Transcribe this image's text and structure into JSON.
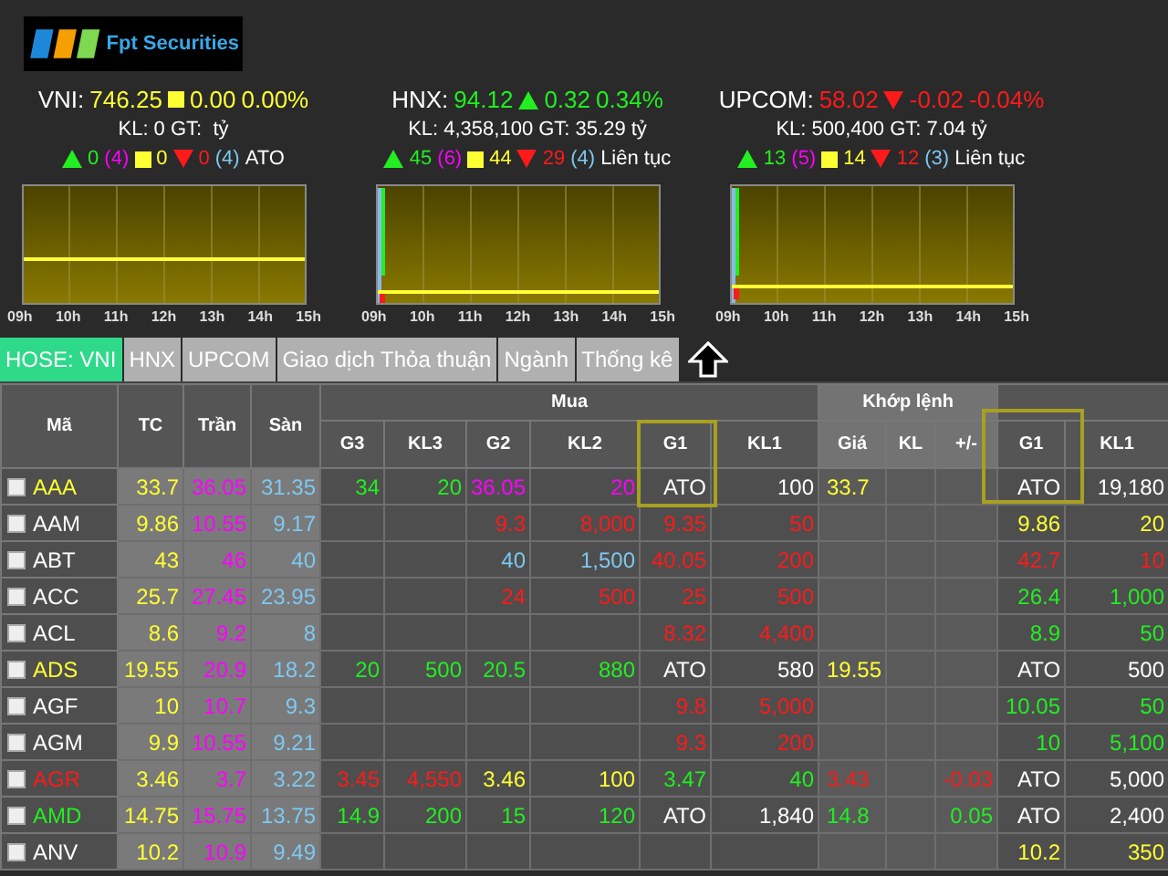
{
  "logo": {
    "text": "Fpt Securities"
  },
  "indices": [
    {
      "name": "VNI:",
      "value": "746.25",
      "kind": "same",
      "change": "0.00",
      "percent": "0.00%",
      "volume": "KL: 0 GT:  tỷ",
      "up": "0",
      "ceiling": "(4)",
      "same": "0",
      "down": "0",
      "floor": "(4)",
      "session": "ATO",
      "hours": [
        "09h",
        "10h",
        "11h",
        "12h",
        "13h",
        "14h",
        "15h"
      ]
    },
    {
      "name": "HNX:",
      "value": "94.12",
      "kind": "up",
      "change": "0.32",
      "percent": "0.34%",
      "volume": "KL: 4,358,100 GT: 35.29 tỷ",
      "up": "45",
      "ceiling": "(6)",
      "same": "44",
      "down": "29",
      "floor": "(4)",
      "session": "Liên tục",
      "hours": [
        "09h",
        "10h",
        "11h",
        "12h",
        "13h",
        "14h",
        "15h"
      ]
    },
    {
      "name": "UPCOM:",
      "value": "58.02",
      "kind": "down",
      "change": "-0.02",
      "percent": "-0.04%",
      "volume": "KL: 500,400 GT: 7.04 tỷ",
      "up": "13",
      "ceiling": "(5)",
      "same": "14",
      "down": "12",
      "floor": "(3)",
      "session": "Liên tục",
      "hours": [
        "09h",
        "10h",
        "11h",
        "12h",
        "13h",
        "14h",
        "15h"
      ]
    }
  ],
  "tabs": [
    {
      "label": "HOSE: VNI",
      "selected": true
    },
    {
      "label": "HNX",
      "selected": false
    },
    {
      "label": "UPCOM",
      "selected": false
    },
    {
      "label": "Giao dịch Thỏa thuận",
      "selected": false
    },
    {
      "label": "Ngành",
      "selected": false
    },
    {
      "label": "Thống kê",
      "selected": false
    }
  ],
  "table": {
    "group_headers": {
      "buy": "Mua",
      "matched": "Khớp lệnh"
    },
    "columns": [
      "Mã",
      "TC",
      "Trần",
      "Sàn",
      "G3",
      "KL3",
      "G2",
      "KL2",
      "G1",
      "KL1",
      "Giá",
      "KL",
      "+/-",
      "G1",
      "KL1"
    ],
    "rows": [
      {
        "checked": false,
        "cells": [
          {
            "text": "AAA",
            "color": "#ffff33"
          },
          {
            "text": "33.7",
            "color": "#ffff33"
          },
          {
            "text": "36.05",
            "color": "#ff00ff"
          },
          {
            "text": "31.35",
            "color": "#7ec8f0"
          },
          {
            "text": "34",
            "color": "#22ee22"
          },
          {
            "text": "20",
            "color": "#22ee22"
          },
          {
            "text": "36.05",
            "color": "#ff00ff"
          },
          {
            "text": "20",
            "color": "#ff00ff"
          },
          {
            "text": "ATO",
            "color": "#ffffff"
          },
          {
            "text": "100",
            "color": "#ffffff"
          },
          {
            "text": "33.7",
            "color": "#ffff33"
          },
          null,
          null,
          {
            "text": "ATO",
            "color": "#ffffff"
          },
          {
            "text": "19,180",
            "color": "#ffffff"
          }
        ]
      },
      {
        "checked": false,
        "cells": [
          {
            "text": "AAM",
            "color": "#ffffff"
          },
          {
            "text": "9.86",
            "color": "#ffff33"
          },
          {
            "text": "10.55",
            "color": "#ff00ff"
          },
          {
            "text": "9.17",
            "color": "#7ec8f0"
          },
          null,
          null,
          {
            "text": "9.3",
            "color": "#ff1a1a"
          },
          {
            "text": "8,000",
            "color": "#ff1a1a"
          },
          {
            "text": "9.35",
            "color": "#ff1a1a"
          },
          {
            "text": "50",
            "color": "#ff1a1a"
          },
          null,
          null,
          null,
          {
            "text": "9.86",
            "color": "#ffff33"
          },
          {
            "text": "20",
            "color": "#ffff33"
          }
        ]
      },
      {
        "checked": false,
        "cells": [
          {
            "text": "ABT",
            "color": "#ffffff"
          },
          {
            "text": "43",
            "color": "#ffff33"
          },
          {
            "text": "46",
            "color": "#ff00ff"
          },
          {
            "text": "40",
            "color": "#7ec8f0"
          },
          null,
          null,
          {
            "text": "40",
            "color": "#7ec8f0"
          },
          {
            "text": "1,500",
            "color": "#7ec8f0"
          },
          {
            "text": "40.05",
            "color": "#ff1a1a"
          },
          {
            "text": "200",
            "color": "#ff1a1a"
          },
          null,
          null,
          null,
          {
            "text": "42.7",
            "color": "#ff1a1a"
          },
          {
            "text": "10",
            "color": "#ff1a1a"
          }
        ]
      },
      {
        "checked": false,
        "cells": [
          {
            "text": "ACC",
            "color": "#ffffff"
          },
          {
            "text": "25.7",
            "color": "#ffff33"
          },
          {
            "text": "27.45",
            "color": "#ff00ff"
          },
          {
            "text": "23.95",
            "color": "#7ec8f0"
          },
          null,
          null,
          {
            "text": "24",
            "color": "#ff1a1a"
          },
          {
            "text": "500",
            "color": "#ff1a1a"
          },
          {
            "text": "25",
            "color": "#ff1a1a"
          },
          {
            "text": "500",
            "color": "#ff1a1a"
          },
          null,
          null,
          null,
          {
            "text": "26.4",
            "color": "#22ee22"
          },
          {
            "text": "1,000",
            "color": "#22ee22"
          }
        ]
      },
      {
        "checked": false,
        "cells": [
          {
            "text": "ACL",
            "color": "#ffffff"
          },
          {
            "text": "8.6",
            "color": "#ffff33"
          },
          {
            "text": "9.2",
            "color": "#ff00ff"
          },
          {
            "text": "8",
            "color": "#7ec8f0"
          },
          null,
          null,
          null,
          null,
          {
            "text": "8.32",
            "color": "#ff1a1a"
          },
          {
            "text": "4,400",
            "color": "#ff1a1a"
          },
          null,
          null,
          null,
          {
            "text": "8.9",
            "color": "#22ee22"
          },
          {
            "text": "50",
            "color": "#22ee22"
          }
        ]
      },
      {
        "checked": false,
        "cells": [
          {
            "text": "ADS",
            "color": "#ffff33"
          },
          {
            "text": "19.55",
            "color": "#ffff33"
          },
          {
            "text": "20.9",
            "color": "#ff00ff"
          },
          {
            "text": "18.2",
            "color": "#7ec8f0"
          },
          {
            "text": "20",
            "color": "#22ee22"
          },
          {
            "text": "500",
            "color": "#22ee22"
          },
          {
            "text": "20.5",
            "color": "#22ee22"
          },
          {
            "text": "880",
            "color": "#22ee22"
          },
          {
            "text": "ATO",
            "color": "#ffffff"
          },
          {
            "text": "580",
            "color": "#ffffff"
          },
          {
            "text": "19.55",
            "color": "#ffff33"
          },
          null,
          null,
          {
            "text": "ATO",
            "color": "#ffffff"
          },
          {
            "text": "500",
            "color": "#ffffff"
          }
        ]
      },
      {
        "checked": false,
        "cells": [
          {
            "text": "AGF",
            "color": "#ffffff"
          },
          {
            "text": "10",
            "color": "#ffff33"
          },
          {
            "text": "10.7",
            "color": "#ff00ff"
          },
          {
            "text": "9.3",
            "color": "#7ec8f0"
          },
          null,
          null,
          null,
          null,
          {
            "text": "9.8",
            "color": "#ff1a1a"
          },
          {
            "text": "5,000",
            "color": "#ff1a1a"
          },
          null,
          null,
          null,
          {
            "text": "10.05",
            "color": "#22ee22"
          },
          {
            "text": "50",
            "color": "#22ee22"
          }
        ]
      },
      {
        "checked": false,
        "cells": [
          {
            "text": "AGM",
            "color": "#ffffff"
          },
          {
            "text": "9.9",
            "color": "#ffff33"
          },
          {
            "text": "10.55",
            "color": "#ff00ff"
          },
          {
            "text": "9.21",
            "color": "#7ec8f0"
          },
          null,
          null,
          null,
          null,
          {
            "text": "9.3",
            "color": "#ff1a1a"
          },
          {
            "text": "200",
            "color": "#ff1a1a"
          },
          null,
          null,
          null,
          {
            "text": "10",
            "color": "#22ee22"
          },
          {
            "text": "5,100",
            "color": "#22ee22"
          }
        ]
      },
      {
        "checked": false,
        "cells": [
          {
            "text": "AGR",
            "color": "#ff1a1a"
          },
          {
            "text": "3.46",
            "color": "#ffff33"
          },
          {
            "text": "3.7",
            "color": "#ff00ff"
          },
          {
            "text": "3.22",
            "color": "#7ec8f0"
          },
          {
            "text": "3.45",
            "color": "#ff1a1a"
          },
          {
            "text": "4,550",
            "color": "#ff1a1a"
          },
          {
            "text": "3.46",
            "color": "#ffff33"
          },
          {
            "text": "100",
            "color": "#ffff33"
          },
          {
            "text": "3.47",
            "color": "#22ee22"
          },
          {
            "text": "40",
            "color": "#22ee22"
          },
          {
            "text": "3.43",
            "color": "#ff1a1a"
          },
          null,
          {
            "text": "-0.03",
            "color": "#ff1a1a"
          },
          {
            "text": "ATO",
            "color": "#ffffff"
          },
          {
            "text": "5,000",
            "color": "#ffffff"
          }
        ]
      },
      {
        "checked": false,
        "cells": [
          {
            "text": "AMD",
            "color": "#22ee22"
          },
          {
            "text": "14.75",
            "color": "#ffff33"
          },
          {
            "text": "15.75",
            "color": "#ff00ff"
          },
          {
            "text": "13.75",
            "color": "#7ec8f0"
          },
          {
            "text": "14.9",
            "color": "#22ee22"
          },
          {
            "text": "200",
            "color": "#22ee22"
          },
          {
            "text": "15",
            "color": "#22ee22"
          },
          {
            "text": "120",
            "color": "#22ee22"
          },
          {
            "text": "ATO",
            "color": "#ffffff"
          },
          {
            "text": "1,840",
            "color": "#ffffff"
          },
          {
            "text": "14.8",
            "color": "#22ee22"
          },
          null,
          {
            "text": "0.05",
            "color": "#22ee22"
          },
          {
            "text": "ATO",
            "color": "#ffffff"
          },
          {
            "text": "2,400",
            "color": "#ffffff"
          }
        ]
      },
      {
        "checked": false,
        "cells": [
          {
            "text": "ANV",
            "color": "#ffffff"
          },
          {
            "text": "10.2",
            "color": "#ffff33"
          },
          {
            "text": "10.9",
            "color": "#ff00ff"
          },
          {
            "text": "9.49",
            "color": "#7ec8f0"
          },
          null,
          null,
          null,
          null,
          null,
          null,
          null,
          null,
          null,
          {
            "text": "10.2",
            "color": "#ffff33"
          },
          {
            "text": "350",
            "color": "#ffff33"
          }
        ]
      }
    ]
  }
}
